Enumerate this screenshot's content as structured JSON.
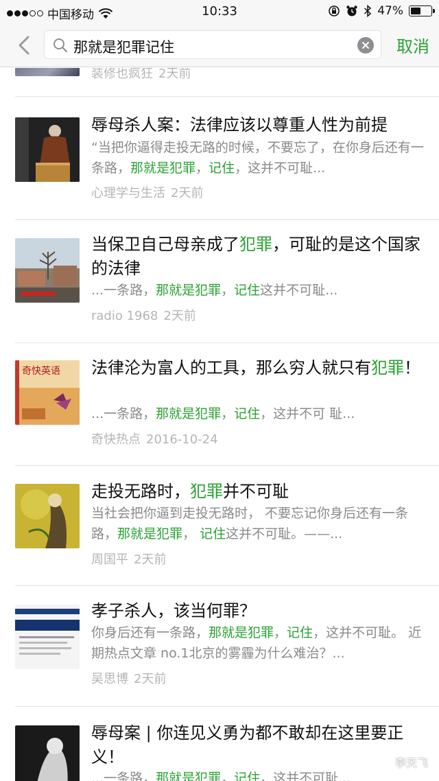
{
  "status": {
    "carrier": "中国移动",
    "time": "10:33",
    "battery": "47%",
    "battery_level": 0.47
  },
  "search": {
    "query": "那就是犯罪记住",
    "cancel": "取消"
  },
  "results": [
    {
      "title_parts": [],
      "snippet_parts": [],
      "source": "装修也疯狂",
      "date": "2天前"
    },
    {
      "title_parts": [
        {
          "t": "辱母杀人案：法律应该以尊重人性为前提",
          "hl": false
        }
      ],
      "snippet_parts": [
        {
          "t": "“当把你逼得走投无路的时候，不要忘了，在你身后还有一条路，",
          "hl": false
        },
        {
          "t": "那就是犯罪",
          "hl": true
        },
        {
          "t": "，",
          "hl": false
        },
        {
          "t": "记住",
          "hl": true
        },
        {
          "t": "，这并不可耻...",
          "hl": false
        }
      ],
      "source": "心理学与生活",
      "date": "2天前"
    },
    {
      "title_parts": [
        {
          "t": "当保卫自己母亲成了",
          "hl": false
        },
        {
          "t": "犯罪",
          "hl": true
        },
        {
          "t": "，可耻的是这个国家的法律",
          "hl": false
        }
      ],
      "snippet_parts": [
        {
          "t": "...一条路，",
          "hl": false
        },
        {
          "t": "那就是犯罪",
          "hl": true
        },
        {
          "t": "，",
          "hl": false
        },
        {
          "t": "记住",
          "hl": true
        },
        {
          "t": "这并不可耻...",
          "hl": false
        }
      ],
      "source": "radio 1968",
      "date": "2天前"
    },
    {
      "title_parts": [
        {
          "t": "法律沦为富人的工具，那么穷人就只有",
          "hl": false
        },
        {
          "t": "犯罪",
          "hl": true
        },
        {
          "t": "！",
          "hl": false
        }
      ],
      "snippet_parts": [
        {
          "t": "...一条路，",
          "hl": false
        },
        {
          "t": "那就是犯罪",
          "hl": true
        },
        {
          "t": "，",
          "hl": false
        },
        {
          "t": "记住",
          "hl": true
        },
        {
          "t": "，这并不可 耻...",
          "hl": false
        }
      ],
      "source": "奇快热点",
      "date": "2016-10-24"
    },
    {
      "title_parts": [
        {
          "t": "走投无路时，",
          "hl": false
        },
        {
          "t": "犯罪",
          "hl": true
        },
        {
          "t": "并不可耻",
          "hl": false
        }
      ],
      "snippet_parts": [
        {
          "t": "当社会把你逼到走投无路时， 不要忘记你身后还有一条路，",
          "hl": false
        },
        {
          "t": "那就是犯罪",
          "hl": true
        },
        {
          "t": "， ",
          "hl": false
        },
        {
          "t": "记住",
          "hl": true
        },
        {
          "t": "这并不可耻。——...",
          "hl": false
        }
      ],
      "source": "周国平",
      "date": "2天前"
    },
    {
      "title_parts": [
        {
          "t": "孝子杀人，该当何罪？",
          "hl": false
        }
      ],
      "snippet_parts": [
        {
          "t": "你身后还有一条路，",
          "hl": false
        },
        {
          "t": "那就是犯罪",
          "hl": true
        },
        {
          "t": "，",
          "hl": false
        },
        {
          "t": "记住",
          "hl": true
        },
        {
          "t": "，这并不可耻。 近期热点文章 no.1北京的雾霾为什么难治？...",
          "hl": false
        }
      ],
      "source": "吴思博",
      "date": "2天前"
    },
    {
      "title_parts": [
        {
          "t": "辱母案 | 你连见义勇为都不敢却在这里要正义！",
          "hl": false
        }
      ],
      "snippet_parts": [
        {
          "t": "...一条路，",
          "hl": false
        },
        {
          "t": "那就是犯罪",
          "hl": true
        },
        {
          "t": "，",
          "hl": false
        },
        {
          "t": "记住",
          "hl": true
        },
        {
          "t": "，这并不可耻...",
          "hl": false
        }
      ],
      "source": "",
      "date": ""
    }
  ],
  "thumb_text": {
    "book_title": "奇快英语"
  },
  "watermark": "李天飞",
  "colors": {
    "highlight": "#2aa233",
    "cancel": "#2aa233",
    "meta": "#b5b5b5",
    "snippet": "#8a8a8a"
  }
}
